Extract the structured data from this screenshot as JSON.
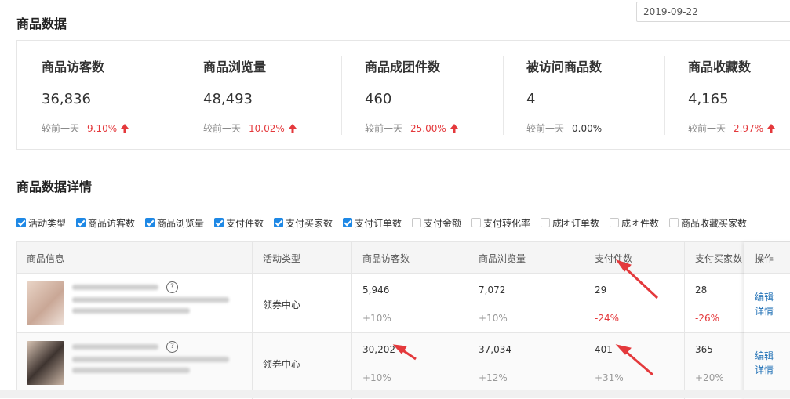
{
  "date": {
    "value": "2019-09-22"
  },
  "section1": {
    "title": "商品数据"
  },
  "stats": [
    {
      "label": "商品访客数",
      "value": "36,836",
      "compare": "较前一天",
      "pct": "9.10%",
      "trend": "up"
    },
    {
      "label": "商品浏览量",
      "value": "48,493",
      "compare": "较前一天",
      "pct": "10.02%",
      "trend": "up"
    },
    {
      "label": "商品成团件数",
      "value": "460",
      "compare": "较前一天",
      "pct": "25.00%",
      "trend": "up"
    },
    {
      "label": "被访问商品数",
      "value": "4",
      "compare": "较前一天",
      "pct": "0.00%",
      "trend": "flat"
    },
    {
      "label": "商品收藏数",
      "value": "4,165",
      "compare": "较前一天",
      "pct": "2.97%",
      "trend": "up"
    }
  ],
  "section2": {
    "title": "商品数据详情"
  },
  "checkboxes": [
    {
      "label": "活动类型",
      "checked": true
    },
    {
      "label": "商品访客数",
      "checked": true
    },
    {
      "label": "商品浏览量",
      "checked": true
    },
    {
      "label": "支付件数",
      "checked": true
    },
    {
      "label": "支付买家数",
      "checked": true
    },
    {
      "label": "支付订单数",
      "checked": true
    },
    {
      "label": "支付金额",
      "checked": false
    },
    {
      "label": "支付转化率",
      "checked": false
    },
    {
      "label": "成团订单数",
      "checked": false
    },
    {
      "label": "成团件数",
      "checked": false
    },
    {
      "label": "商品收藏买家数",
      "checked": false
    }
  ],
  "table": {
    "headers": [
      "商品信息",
      "活动类型",
      "商品访客数",
      "商品浏览量",
      "支付件数",
      "支付买家数",
      "操作"
    ],
    "rows": [
      {
        "activity": "领券中心",
        "visitors": "5,946",
        "visitors_change": "+10%",
        "views": "7,072",
        "views_change": "+10%",
        "pay_items": "29",
        "pay_items_change": "-24%",
        "buyers": "28",
        "buyers_change": "-26%",
        "op_edit": "编辑",
        "op_detail": "详情"
      },
      {
        "activity": "领券中心",
        "visitors": "30,202",
        "visitors_change": "+10%",
        "views": "37,034",
        "views_change": "+12%",
        "pay_items": "401",
        "pay_items_change": "+31%",
        "buyers": "365",
        "buyers_change": "+20%",
        "op_edit": "编辑",
        "op_detail": "详情"
      }
    ]
  },
  "colors": {
    "accent": "#1e88e5",
    "up": "#e4393c",
    "link": "#1e6fb5"
  },
  "icons": {
    "trend_up": "arrow-up-icon",
    "help": "question-circle-icon"
  }
}
